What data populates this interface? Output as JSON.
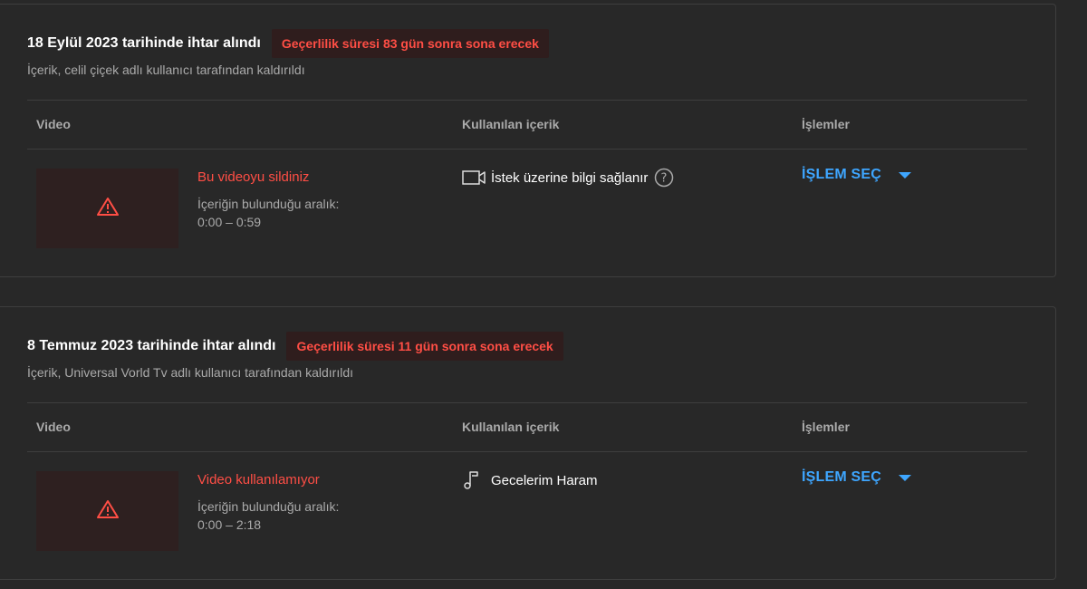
{
  "strikes": [
    {
      "date_text": "18 Eylül 2023 tarihinde ihtar alındı",
      "expiry_text": "Geçerlilik süresi 83 gün sonra sona erecek",
      "removed_by_text": "İçerik, celil çiçek adlı kullanıcı tarafından kaldırıldı",
      "columns": {
        "video": "Video",
        "content": "Kullanılan içerik",
        "actions": "İşlemler"
      },
      "video_status": "Bu videoyu sildiniz",
      "range_label": "İçeriğin bulunduğu aralık:",
      "range_value": "0:00 – 0:59",
      "content_icon": "video-camera-icon",
      "content_title": "İstek üzerine bilgi sağlanır",
      "action_label": "İŞLEM SEÇ"
    },
    {
      "date_text": "8 Temmuz 2023 tarihinde ihtar alındı",
      "expiry_text": "Geçerlilik süresi 11 gün sonra sona erecek",
      "removed_by_text": "İçerik, Universal Vorld Tv adlı kullanıcı tarafından kaldırıldı",
      "columns": {
        "video": "Video",
        "content": "Kullanılan içerik",
        "actions": "İşlemler"
      },
      "video_status": "Video kullanılamıyor",
      "range_label": "İçeriğin bulunduğu aralık:",
      "range_value": "0:00 – 2:18",
      "content_icon": "music-note-icon",
      "content_title": "Gecelerim Haram",
      "action_label": "İŞLEM SEÇ"
    }
  ],
  "colors": {
    "background": "#282828",
    "alert_red": "#ff4e45",
    "action_blue": "#3ea6ff",
    "muted_text": "#aaaaaa"
  }
}
